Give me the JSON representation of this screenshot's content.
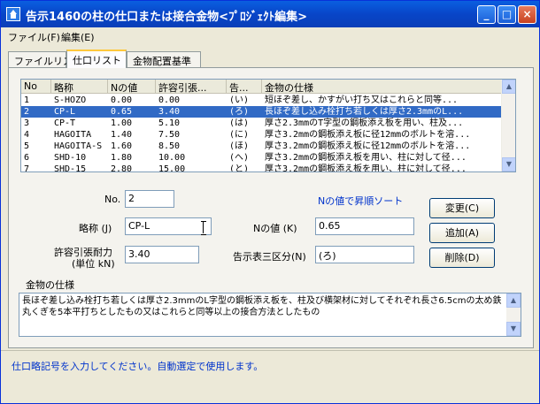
{
  "window": {
    "title": "告示1460の柱の仕口または接合金物<ﾌﾟﾛｼﾞｪｸﾄ編集>",
    "minimize_glyph": "_",
    "maximize_glyph": "□",
    "close_glyph": "×"
  },
  "menu": [
    {
      "label": "ファイル(F)"
    },
    {
      "label": "編集(E)"
    }
  ],
  "tabs": [
    {
      "label": "ファイルリスト",
      "active": false
    },
    {
      "label": "仕口リスト",
      "active": true
    },
    {
      "label": "金物配置基準",
      "active": false
    }
  ],
  "list": {
    "columns": [
      "No",
      "略称",
      "Nの値",
      "許容引張...",
      "告...",
      "金物の仕様"
    ],
    "rows": [
      {
        "no": "1",
        "abbr": "S-HOZO",
        "n": "0.00",
        "allow": "0.00",
        "kokuji": "(い)",
        "spec": "短ほぞ差し、かすがい打ち又はこれらと同等..."
      },
      {
        "no": "2",
        "abbr": "CP-L",
        "n": "0.65",
        "allow": "3.40",
        "kokuji": "(ろ)",
        "spec": "長ほぞ差し込み栓打ち若しくは厚さ2.3mmのL..."
      },
      {
        "no": "3",
        "abbr": "CP-T",
        "n": "1.00",
        "allow": "5.10",
        "kokuji": "(は)",
        "spec": "厚さ2.3mmのT字型の鋼板添え板を用い、柱及..."
      },
      {
        "no": "4",
        "abbr": "HAGOITA",
        "n": "1.40",
        "allow": "7.50",
        "kokuji": "(に)",
        "spec": "厚さ3.2mmの鋼板添え板に径12mmのボルトを溶..."
      },
      {
        "no": "5",
        "abbr": "HAGOITA-S",
        "n": "1.60",
        "allow": "8.50",
        "kokuji": "(ほ)",
        "spec": "厚さ3.2mmの鋼板添え板に径12mmのボルトを溶..."
      },
      {
        "no": "6",
        "abbr": "SHD-10",
        "n": "1.80",
        "allow": "10.00",
        "kokuji": "(へ)",
        "spec": "厚さ3.2mmの鋼板添え板を用い、柱に対して径..."
      },
      {
        "no": "7",
        "abbr": "SHD-15",
        "n": "2.80",
        "allow": "15.00",
        "kokuji": "(と)",
        "spec": "厚さ3.2mmの鋼板添え板を用い、柱に対して径..."
      }
    ],
    "selected_index": 1
  },
  "form": {
    "no_label": "No.",
    "no_value": "2",
    "sort_note": "Nの値で昇順ソート",
    "abbr_label": "略称 (J)",
    "abbr_value": "CP-L",
    "n_label": "Nの値 (K)",
    "n_value": "0.65",
    "allow_label_1": "許容引張耐力",
    "allow_label_2": "(単位 kN)",
    "allow_value": "3.40",
    "kokuji_label": "告示表三区分(N)",
    "kokuji_value": "(ろ)",
    "spec_label": "金物の仕様",
    "spec_value": "長ほぞ差し込み栓打ち若しくは厚さ2.3mmのL字型の鋼板添え板を、柱及び横架材に対してそれぞれ長さ6.5cmの太め鉄丸くぎを5本平打ちとしたもの又はこれらと同等以上の接合方法としたもの"
  },
  "buttons": {
    "change": "変更(C)",
    "add": "追加(A)",
    "delete": "削除(D)"
  },
  "status": {
    "message": "仕口略記号を入力してください。自動選定で使用します。"
  }
}
